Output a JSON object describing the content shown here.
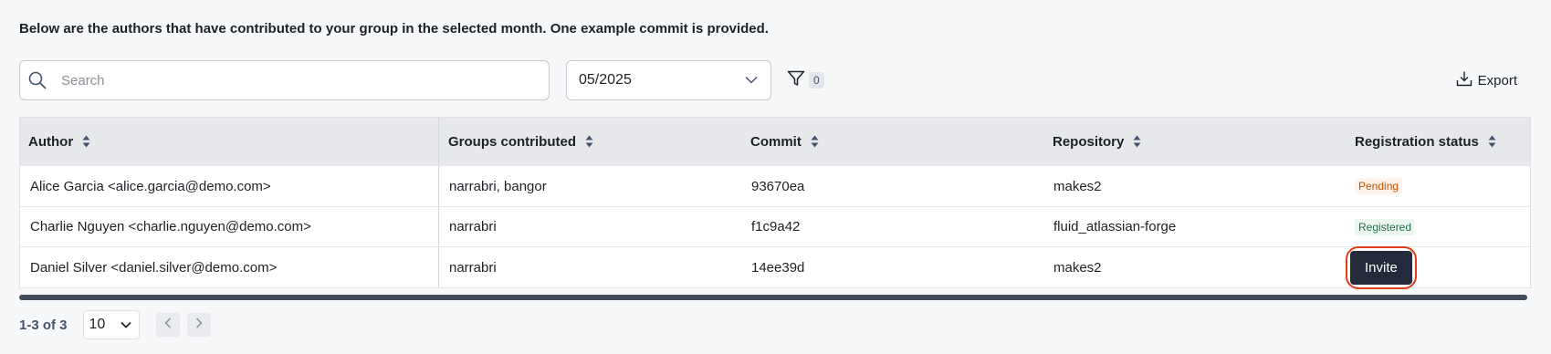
{
  "intro_text": "Below are the authors that have contributed to your group in the selected month. One example commit is provided.",
  "search": {
    "placeholder": "Search"
  },
  "date_filter": {
    "value": "05/2025"
  },
  "filter": {
    "count": "0"
  },
  "export_label": "Export",
  "table": {
    "columns": [
      "Author",
      "Groups contributed",
      "Commit",
      "Repository",
      "Registration status"
    ],
    "rows": [
      {
        "author": "Alice Garcia <alice.garcia@demo.com>",
        "groups": "narrabri, bangor",
        "commit": "93670ea",
        "repository": "makes2",
        "status": "Pending"
      },
      {
        "author": "Charlie Nguyen <charlie.nguyen@demo.com>",
        "groups": "narrabri",
        "commit": "f1c9a42",
        "repository": "fluid_atlassian-forge",
        "status": "Registered"
      },
      {
        "author": "Daniel Silver <daniel.silver@demo.com>",
        "groups": "narrabri",
        "commit": "14ee39d",
        "repository": "makes2",
        "status": "Invite"
      }
    ]
  },
  "pagination": {
    "range": "1-3 of 3",
    "page_size": "10"
  },
  "colors": {
    "pending": "#c25100",
    "registered": "#216e4e",
    "invite_button": "#232b3a",
    "highlight": "#e03e1a"
  }
}
